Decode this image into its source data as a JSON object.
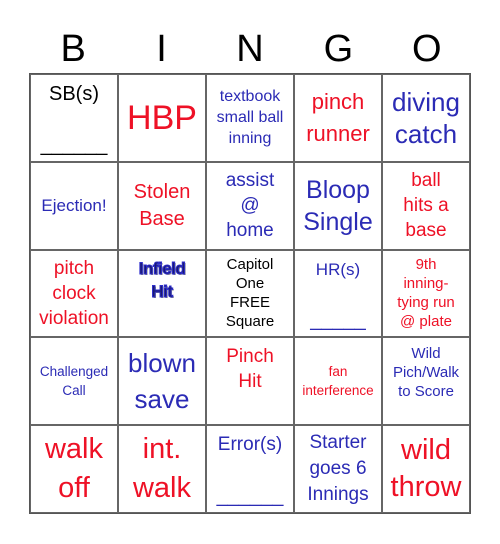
{
  "header": {
    "letters": [
      "B",
      "I",
      "N",
      "G",
      "O"
    ]
  },
  "colors": {
    "red": "#ee1126",
    "blue": "#2b2bb5",
    "black": "#000000"
  },
  "cells": [
    {
      "text": "SB(s)",
      "blank": "______",
      "color": "black"
    },
    {
      "text": "HBP",
      "color": "red"
    },
    {
      "text": "textbook\nsmall ball\ninning",
      "color": "blue"
    },
    {
      "text": "pinch\nrunner",
      "color": "red"
    },
    {
      "text": "diving\ncatch",
      "color": "blue"
    },
    {
      "text": "Ejection!",
      "color": "blue"
    },
    {
      "text": "Stolen\nBase",
      "color": "red"
    },
    {
      "text": "assist\n@\nhome",
      "color": "blue"
    },
    {
      "text": "Bloop\nSingle",
      "color": "blue"
    },
    {
      "text": "ball\nhits a\nbase",
      "color": "red"
    },
    {
      "text": "pitch\nclock\nviolation",
      "color": "red"
    },
    {
      "text": "Infield\nHit",
      "color": "navy-outlined"
    },
    {
      "text": "Capitol\nOne\nFREE\nSquare",
      "color": "black",
      "free": true
    },
    {
      "text": "HR(s)",
      "blank": "_____",
      "color": "blue"
    },
    {
      "text": "9th\ninning-\ntying run\n@ plate",
      "color": "red"
    },
    {
      "text": "Challenged\nCall",
      "color": "blue"
    },
    {
      "text": "blown\nsave",
      "color": "blue"
    },
    {
      "text": "Pinch\nHit",
      "color": "red"
    },
    {
      "text": "fan\ninterference",
      "color": "red"
    },
    {
      "text": "Wild\nPich/Walk\nto Score",
      "color": "blue"
    },
    {
      "text": "walk\noff",
      "color": "red"
    },
    {
      "text": "int.\nwalk",
      "color": "red"
    },
    {
      "text": "Error(s)",
      "blank": "______",
      "color": "blue"
    },
    {
      "text": "Starter\ngoes 6\nInnings",
      "color": "blue"
    },
    {
      "text": "wild\nthrow",
      "color": "red"
    }
  ]
}
